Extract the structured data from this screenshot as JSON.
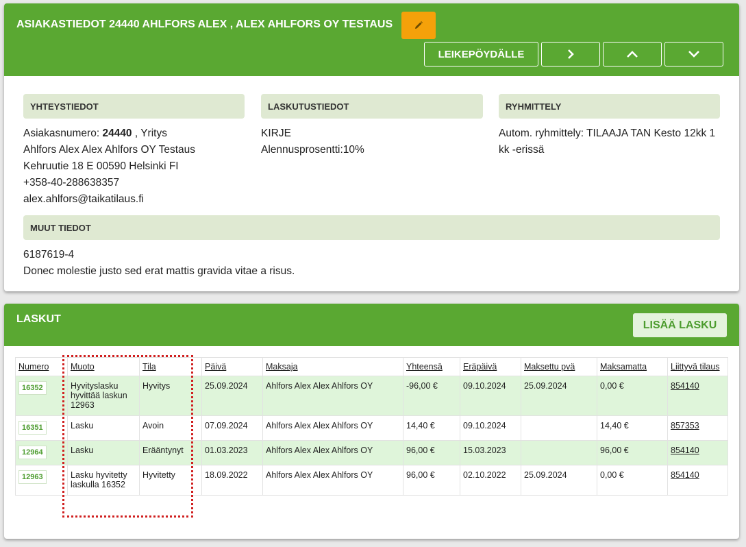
{
  "customer": {
    "header_title": "ASIAKASTIEDOT 24440 AHLFORS ALEX , ALEX AHLFORS OY TESTAUS",
    "toolbar": {
      "clipboard_label": "LEIKEPÖYDÄLLE"
    },
    "contact": {
      "heading": "YHTEYSTIEDOT",
      "number_label": "Asiakasnumero:",
      "number": "24440",
      "type": ", Yritys",
      "name": "Ahlfors Alex Alex Ahlfors OY Testaus",
      "address": "Kehruutie 18 E 00590 Helsinki FI",
      "phone": "+358-40-288638357",
      "email": "alex.ahlfors@taikatilaus.fi"
    },
    "billing": {
      "heading": "LASKUTUSTIEDOT",
      "method": "KIRJE",
      "discount": "Alennusprosentti:10%"
    },
    "grouping": {
      "heading": "RYHMITTELY",
      "text": "Autom. ryhmittely: TILAAJA TAN Kesto 12kk 1 kk -erissä"
    },
    "other": {
      "heading": "MUUT TIEDOT",
      "line1": "6187619-4",
      "line2": "Donec molestie justo sed erat mattis gravida vitae a risus."
    }
  },
  "invoices": {
    "header_title": "LASKUT",
    "add_label": "LISÄÄ LASKU",
    "columns": [
      "Numero",
      "Muoto",
      "Tila",
      "Päivä",
      "Maksaja",
      "Yhteensä",
      "Eräpäivä",
      "Maksettu pvä",
      "Maksamatta",
      "Liittyvä tilaus"
    ],
    "rows": [
      {
        "numero": "16352",
        "muoto": "Hyvityslasku hyvittää laskun 12963",
        "tila": "Hyvitys",
        "paiva": "25.09.2024",
        "maksaja": "Ahlfors Alex Alex Ahlfors OY",
        "yhteensa": "-96,00 €",
        "erapaiva": "09.10.2024",
        "maksettu": "25.09.2024",
        "maksamatta": "0,00 €",
        "tilaus": "854140"
      },
      {
        "numero": "16351",
        "muoto": "Lasku",
        "tila": "Avoin",
        "paiva": "07.09.2024",
        "maksaja": "Ahlfors Alex Alex Ahlfors OY",
        "yhteensa": "14,40 €",
        "erapaiva": "09.10.2024",
        "maksettu": "",
        "maksamatta": "14,40 €",
        "tilaus": "857353"
      },
      {
        "numero": "12964",
        "muoto": "Lasku",
        "tila": "Erääntynyt",
        "paiva": "01.03.2023",
        "maksaja": "Ahlfors Alex Alex Ahlfors OY",
        "yhteensa": "96,00 €",
        "erapaiva": "15.03.2023",
        "maksettu": "",
        "maksamatta": "96,00 €",
        "tilaus": "854140"
      },
      {
        "numero": "12963",
        "muoto": "Lasku hyvitetty laskulla 16352",
        "tila": "Hyvitetty",
        "paiva": "18.09.2022",
        "maksaja": "Ahlfors Alex Alex Ahlfors OY",
        "yhteensa": "96,00 €",
        "erapaiva": "02.10.2022",
        "maksettu": "25.09.2024",
        "maksamatta": "0,00 €",
        "tilaus": "854140"
      }
    ]
  },
  "colors": {
    "header_green": "#5aa832",
    "edit_orange": "#f5a10a",
    "section_bg": "#dfe9d2",
    "row_highlight": "#dff5da",
    "highlight_border": "#d02020"
  },
  "icons": {
    "edit": "pencil-icon",
    "next": "chevron-right-icon",
    "up": "chevron-up-icon",
    "down": "chevron-down-icon"
  }
}
